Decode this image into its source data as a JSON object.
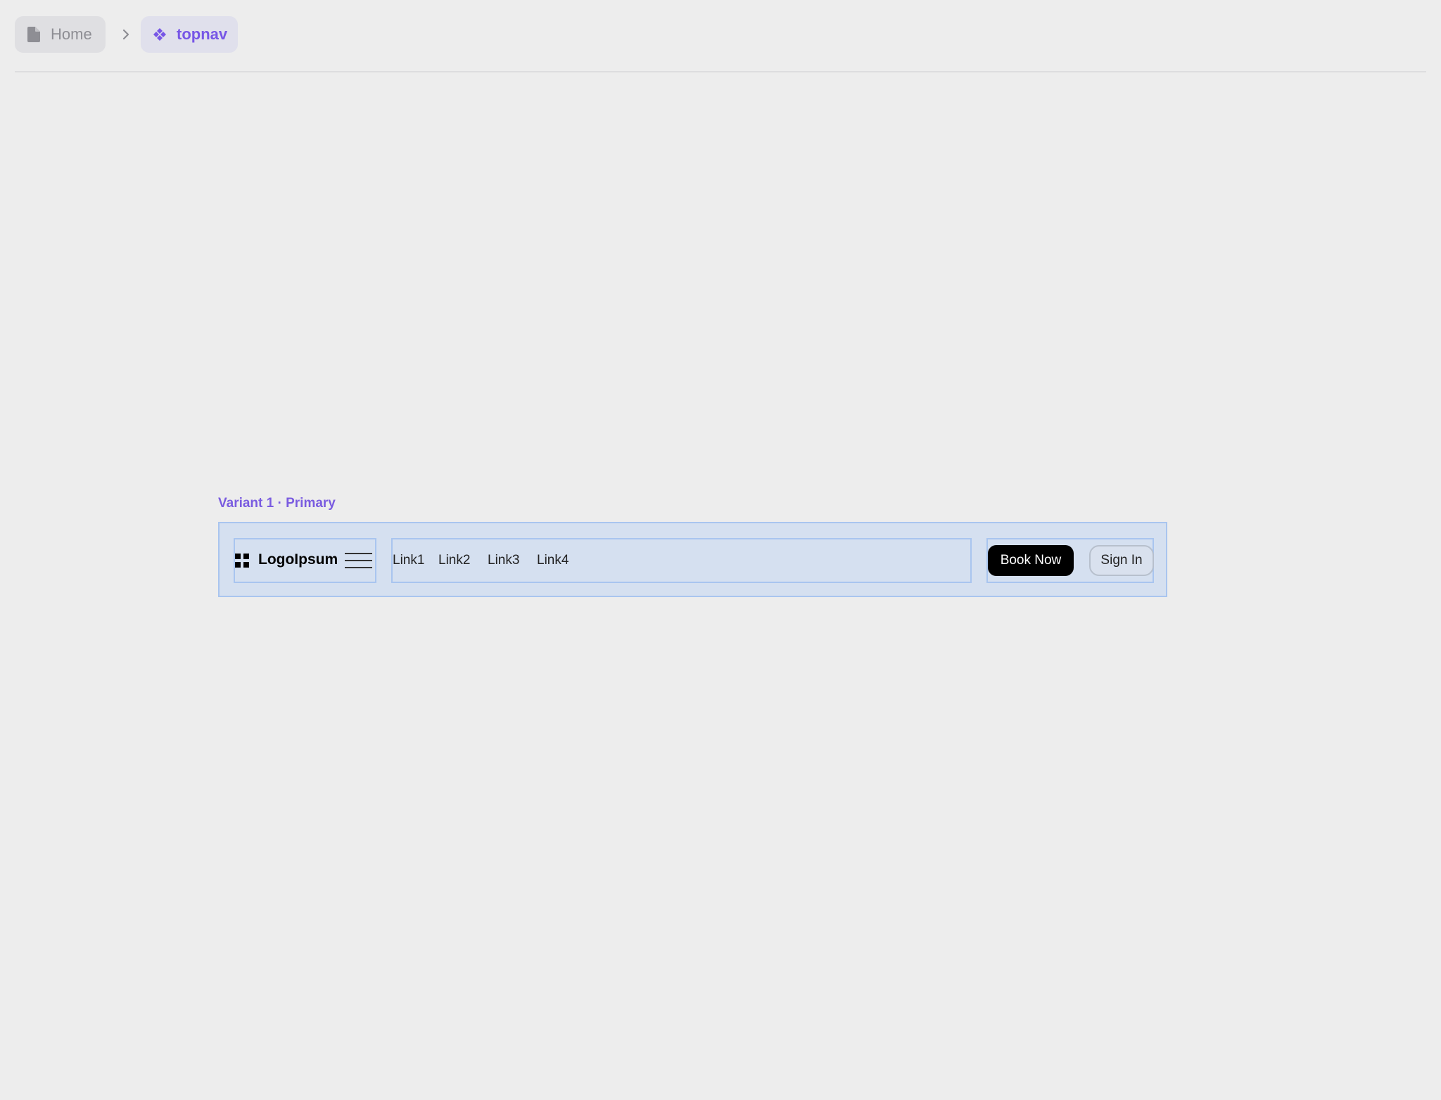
{
  "breadcrumb": {
    "home_label": "Home",
    "current_label": "topnav",
    "home_icon": "file-icon",
    "separator_icon": "chevron-right-icon",
    "current_icon": "component-icon"
  },
  "variant": {
    "label": "Variant 1 · Primary"
  },
  "topnav": {
    "brand": {
      "logo_icon": "grid-logo-icon",
      "name": "LogoIpsum",
      "menu_icon": "hamburger-menu-icon"
    },
    "links": [
      "Link1",
      "Link2",
      "Link3",
      "Link4"
    ],
    "actions": {
      "primary_label": "Book Now",
      "secondary_label": "Sign In"
    }
  },
  "colors": {
    "accent": "#7756e6",
    "frame_fill": "#d5e0f0",
    "frame_border": "#a9c5ef",
    "primary_button": "#000000",
    "background": "#ededed"
  }
}
